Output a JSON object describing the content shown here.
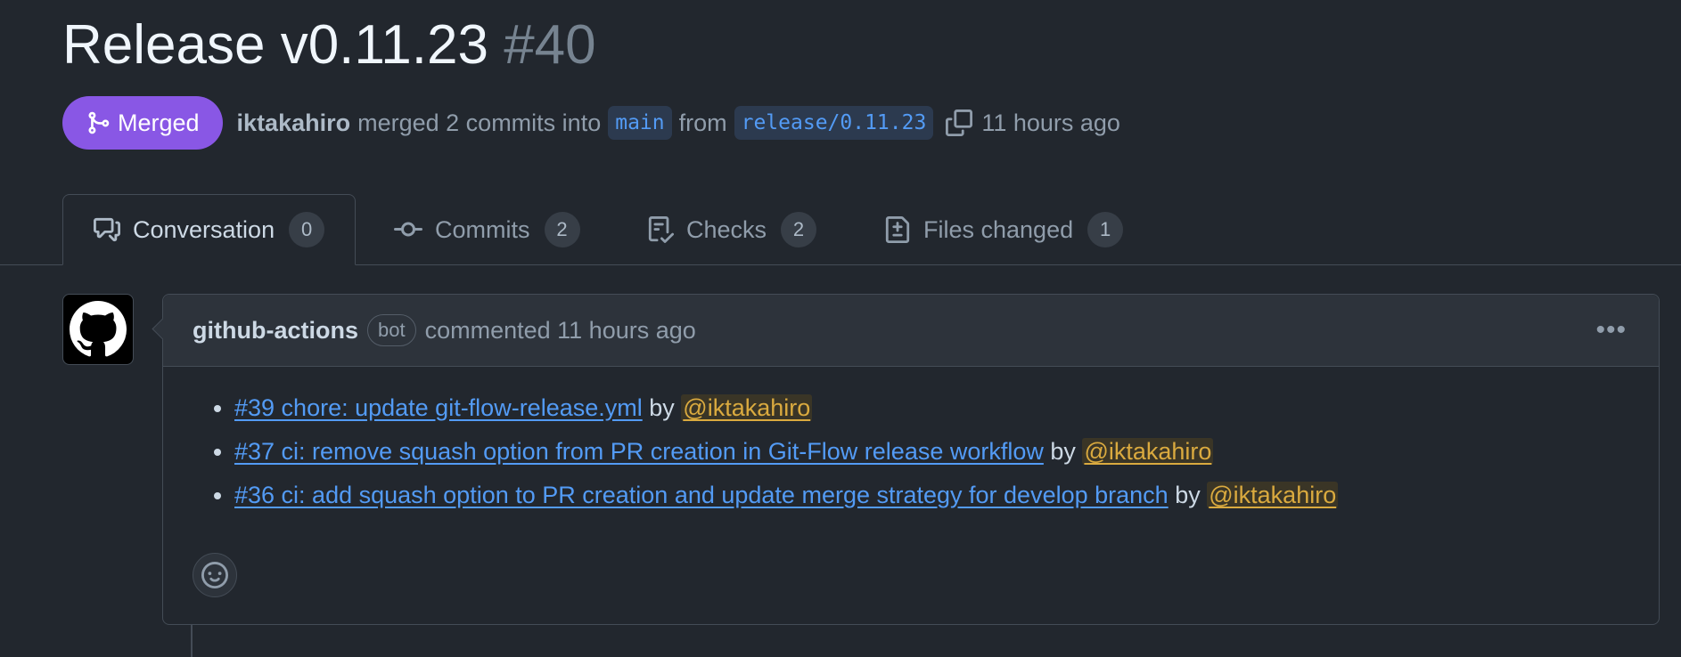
{
  "pr": {
    "title": "Release v0.11.23",
    "number": "#40",
    "state_label": "Merged",
    "author": "iktakahiro",
    "merged_text": "merged 2 commits into",
    "base_branch": "main",
    "from_text": "from",
    "head_branch": "release/0.11.23",
    "time_ago": "11 hours ago"
  },
  "tabs": [
    {
      "label": "Conversation",
      "count": "0",
      "icon": "comment-discussion-icon"
    },
    {
      "label": "Commits",
      "count": "2",
      "icon": "git-commit-icon"
    },
    {
      "label": "Checks",
      "count": "2",
      "icon": "checklist-icon"
    },
    {
      "label": "Files changed",
      "count": "1",
      "icon": "file-diff-icon"
    }
  ],
  "comment": {
    "author": "github-actions",
    "badge": "bot",
    "action_text": "commented 11 hours ago",
    "by_text": "by",
    "items": [
      {
        "link": "#39 chore: update git-flow-release.yml",
        "mention": "@iktakahiro"
      },
      {
        "link": "#37 ci: remove squash option from PR creation in Git-Flow release workflow",
        "mention": "@iktakahiro"
      },
      {
        "link": "#36 ci: add squash option to PR creation and update merge strategy for develop branch",
        "mention": "@iktakahiro"
      }
    ]
  },
  "colors": {
    "background": "#22272e",
    "merged": "#8957e5",
    "link": "#539bf5",
    "mention": "#daaa3f"
  }
}
